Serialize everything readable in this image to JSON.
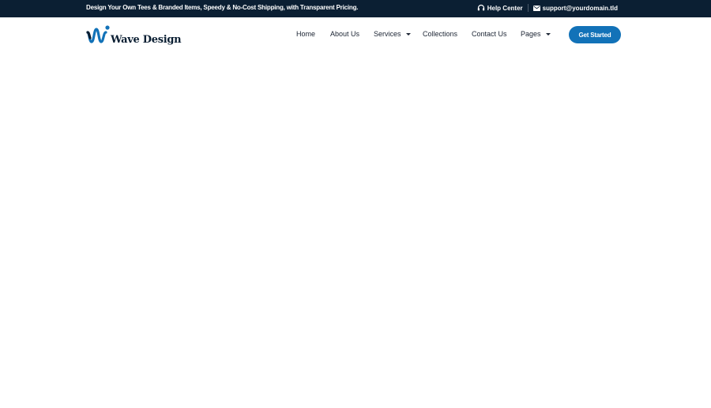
{
  "topbar": {
    "promo": "Design Your Own Tees & Branded Items, Speedy & No-Cost Shipping, with Transparent Pricing.",
    "help": {
      "label": "Help Center",
      "icon": "headset-icon"
    },
    "email": {
      "label": "support@yourdomain.tld",
      "icon": "envelope-icon"
    }
  },
  "logo": {
    "text": "Wave Design",
    "icon": "wave-logo-icon"
  },
  "nav": {
    "items": [
      {
        "label": "Home"
      },
      {
        "label": "About Us"
      },
      {
        "label": "Services",
        "dropdown": true
      },
      {
        "label": "Collections"
      },
      {
        "label": "Contact Us"
      },
      {
        "label": "Pages",
        "dropdown": true
      }
    ]
  },
  "cta": {
    "label": "Get Started"
  },
  "colors": {
    "topbar_bg": "#0b1f33",
    "accent": "#1272b8",
    "text": "#1a2332",
    "background": "#ffffff"
  }
}
